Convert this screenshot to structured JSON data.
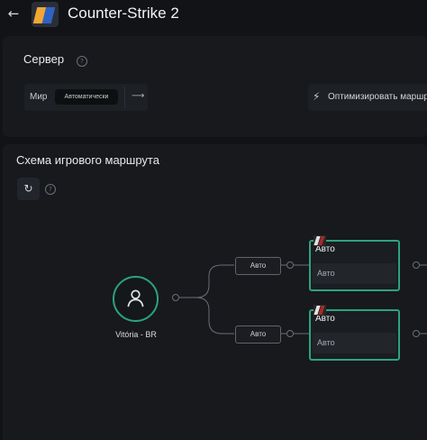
{
  "header": {
    "back_icon": "arrow-left-icon",
    "game_icon": "counter-strike-icon",
    "game_title": "Counter-Strike 2"
  },
  "server": {
    "title": "Сервер",
    "help_icon": "help-circle-icon",
    "region_label": "Мир",
    "region_value": "Автоматически",
    "route_icon": "route-icon",
    "optimize_label": "Оптимизировать маршрут",
    "optimize_icon": "lightning-icon"
  },
  "route": {
    "title": "Схема игрового маршрута",
    "refresh_icon": "refresh-icon",
    "help_icon": "help-circle-icon",
    "user": {
      "label": "Vitória - BR",
      "icon": "user-icon"
    },
    "branches": [
      {
        "mode": "Авто",
        "node_title": "Авто",
        "node_value": "Авто"
      },
      {
        "mode": "Авто",
        "node_title": "Авто",
        "node_value": "Авто"
      }
    ]
  },
  "colors": {
    "accent": "#2ea27f",
    "background": "#121316",
    "panel": "#17191d"
  }
}
